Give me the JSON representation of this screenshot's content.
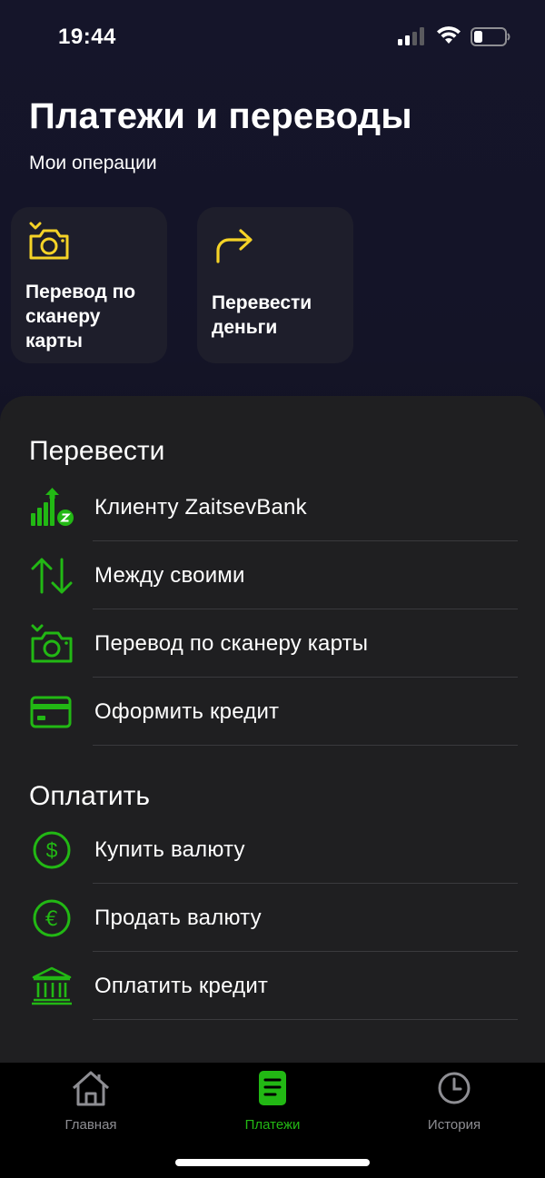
{
  "status_bar": {
    "time": "19:44"
  },
  "header": {
    "title": "Платежи и переводы",
    "subtitle": "Мои операции"
  },
  "quick_actions": [
    {
      "icon": "camera-icon",
      "label": "Перевод по сканеру карты"
    },
    {
      "icon": "forward-arrow-icon",
      "label": "Перевести деньги"
    }
  ],
  "transfer_section": {
    "title": "Перевести",
    "items": [
      {
        "icon": "zaitsevbank-client-icon",
        "label": "Клиенту ZaitsevBank"
      },
      {
        "icon": "swap-arrows-icon",
        "label": "Между своими"
      },
      {
        "icon": "camera-icon",
        "label": "Перевод по сканеру карты"
      },
      {
        "icon": "credit-card-icon",
        "label": "Оформить кредит"
      }
    ]
  },
  "pay_section": {
    "title": "Оплатить",
    "items": [
      {
        "icon": "dollar-icon",
        "label": "Купить валюту"
      },
      {
        "icon": "euro-icon",
        "label": "Продать валюту"
      },
      {
        "icon": "bank-icon",
        "label": "Оплатить кредит"
      }
    ]
  },
  "tab_bar": {
    "tabs": [
      {
        "icon": "home-icon",
        "label": "Главная",
        "active": false
      },
      {
        "icon": "payments-icon",
        "label": "Платежи",
        "active": true
      },
      {
        "icon": "clock-icon",
        "label": "История",
        "active": false
      }
    ]
  },
  "colors": {
    "accent_green": "#22b814",
    "accent_yellow": "#f5d327",
    "sheet_bg": "#1f1f21"
  }
}
